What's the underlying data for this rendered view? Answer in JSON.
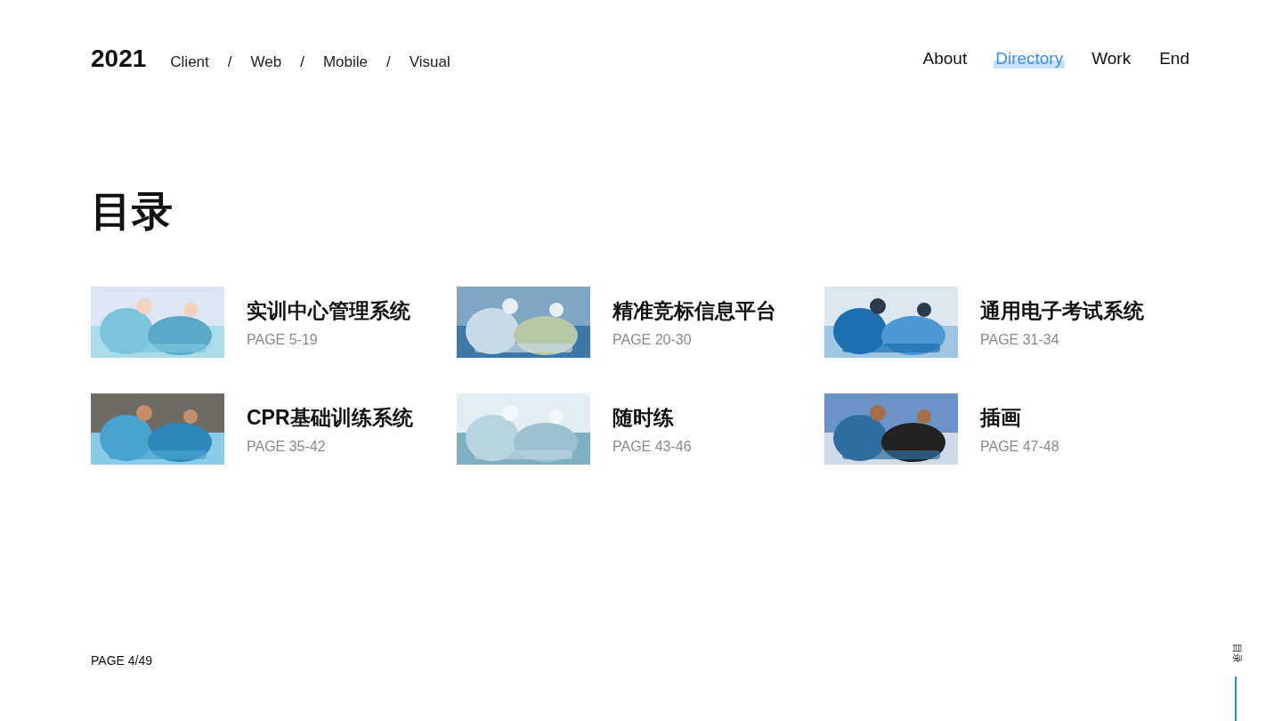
{
  "header": {
    "year": "2021",
    "categories": [
      "Client",
      "Web",
      "Mobile",
      "Visual"
    ],
    "separator": "/"
  },
  "nav": [
    {
      "label": "About",
      "selected": false
    },
    {
      "label": "Directory",
      "selected": true
    },
    {
      "label": "Work",
      "selected": false
    },
    {
      "label": "End",
      "selected": false
    }
  ],
  "title": "目录",
  "entries": [
    {
      "kind": "picture",
      "title": "实训中心管理系统",
      "pages": "PAGE 5-19"
    },
    {
      "kind": "picture",
      "title": "精准竞标信息平台",
      "pages": "PAGE 20-30"
    },
    {
      "kind": "picture",
      "title": "通用电子考试系统",
      "pages": "PAGE 31-34"
    },
    {
      "kind": "picture",
      "title": "CPR基础训练系统",
      "pages": "PAGE 35-42"
    },
    {
      "kind": "picture",
      "title": "随时练",
      "pages": "PAGE 43-46"
    },
    {
      "kind": "picture",
      "title": "插画",
      "pages": "PAGE 47-48"
    }
  ],
  "footer": {
    "page": "PAGE 4/49",
    "side_label": "目录"
  }
}
